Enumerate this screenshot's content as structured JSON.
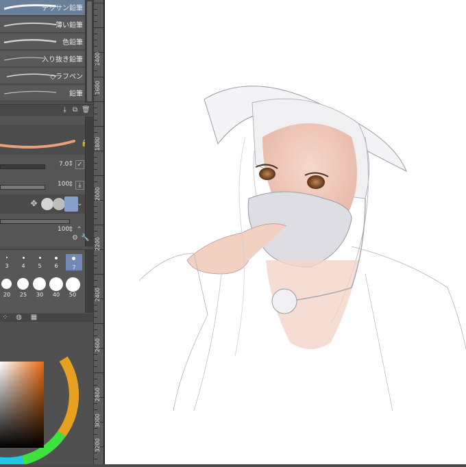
{
  "brushes": {
    "items": [
      {
        "label": "デッサン鉛筆",
        "selected": true
      },
      {
        "label": "薄い鉛筆",
        "selected": false
      },
      {
        "label": "色鉛筆",
        "selected": false
      },
      {
        "label": "入り抜き鉛筆",
        "selected": false
      },
      {
        "label": "◇ラフペン",
        "selected": false
      },
      {
        "label": "鉛筆",
        "selected": false
      }
    ]
  },
  "tool_property": {
    "brush_size_value": "7.0",
    "opacity_value": "100",
    "density_value": "100",
    "opacity_fill": 1.0,
    "density_fill": 1.0
  },
  "brush_size_palette": {
    "small_labels": [
      "3",
      "4",
      "5",
      "6",
      "7"
    ],
    "large_labels": [
      "20",
      "25",
      "30",
      "40",
      "50"
    ],
    "selected": "7"
  },
  "ruler_labels": [
    "1400",
    "1600",
    "1800",
    "2000",
    "2200",
    "2400",
    "2600",
    "2800",
    "3000",
    "3200"
  ],
  "colors": {
    "panel_bg": "#505050",
    "selected_brush": "#6a7f9a",
    "stroke_orange": "#e8a07a",
    "main_color": "#c85a1a"
  }
}
